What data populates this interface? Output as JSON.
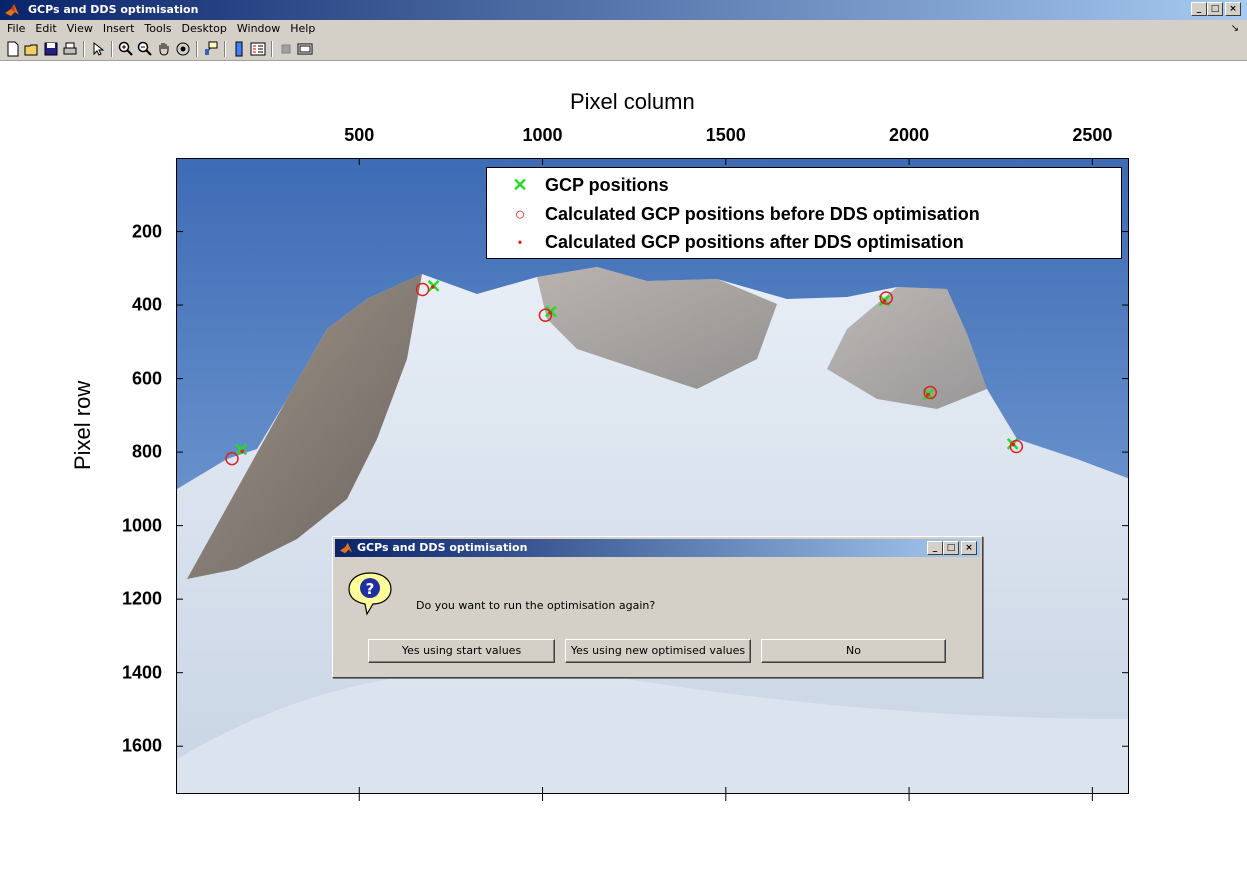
{
  "window": {
    "title": "GCPs and DDS optimisation",
    "menu": [
      "File",
      "Edit",
      "View",
      "Insert",
      "Tools",
      "Desktop",
      "Window",
      "Help"
    ],
    "dock_arrow": "↘",
    "minimize": "_",
    "maximize": "□",
    "close": "×"
  },
  "toolbar": {
    "icons": [
      "new-figure-icon",
      "open-file-icon",
      "save-icon",
      "print-icon",
      "edit-plot-icon",
      "zoom-in-icon",
      "zoom-out-icon",
      "pan-hand-icon",
      "rotate-3d-icon",
      "data-cursor-icon",
      "insert-colorbar-icon",
      "insert-legend-icon",
      "hide-plot-tools-icon",
      "show-plot-tools-icon"
    ]
  },
  "colors": {
    "gcp_marker": "#22dd22",
    "before_marker": "#dd2222",
    "after_marker": "#dd2222",
    "titlebar_start": "#0a246a",
    "titlebar_end": "#a6caf0",
    "face": "#d4d0c8"
  },
  "chart_data": {
    "type": "scatter",
    "title": "Pixel column",
    "xlabel": "Pixel column",
    "ylabel": "Pixel row",
    "xlim": [
      0,
      2600
    ],
    "ylim": [
      1730,
      0
    ],
    "xticks": [
      500,
      1000,
      1500,
      2000,
      2500
    ],
    "yticks": [
      200,
      400,
      600,
      800,
      1000,
      1200,
      1400,
      1600
    ],
    "background": "photograph of snow-covered mountain under blue sky",
    "legend_position": "top-right",
    "series": [
      {
        "name": "GCP positions",
        "marker": "x",
        "color": "#22dd22",
        "points": [
          [
            175,
            790
          ],
          [
            700,
            345
          ],
          [
            1020,
            415
          ],
          [
            1930,
            385
          ],
          [
            2050,
            640
          ],
          [
            2280,
            775
          ]
        ]
      },
      {
        "name": "Calculated GCP positions before DDS optimisation",
        "marker": "o",
        "color": "#dd2222",
        "points": [
          [
            150,
            815
          ],
          [
            670,
            355
          ],
          [
            1005,
            425
          ],
          [
            1935,
            378
          ],
          [
            2055,
            635
          ],
          [
            2290,
            782
          ]
        ]
      },
      {
        "name": "Calculated GCP positions after DDS optimisation",
        "marker": ".",
        "color": "#dd2222",
        "points": [
          [
            178,
            795
          ],
          [
            698,
            348
          ],
          [
            1018,
            418
          ],
          [
            1930,
            386
          ],
          [
            2049,
            641
          ],
          [
            2282,
            777
          ]
        ]
      }
    ]
  },
  "dialog": {
    "title": "GCPs and DDS optimisation",
    "message": "Do you want to run the optimisation again?",
    "icon": "question-icon",
    "buttons": [
      "Yes using start values",
      "Yes using new optimised values",
      "No"
    ]
  }
}
